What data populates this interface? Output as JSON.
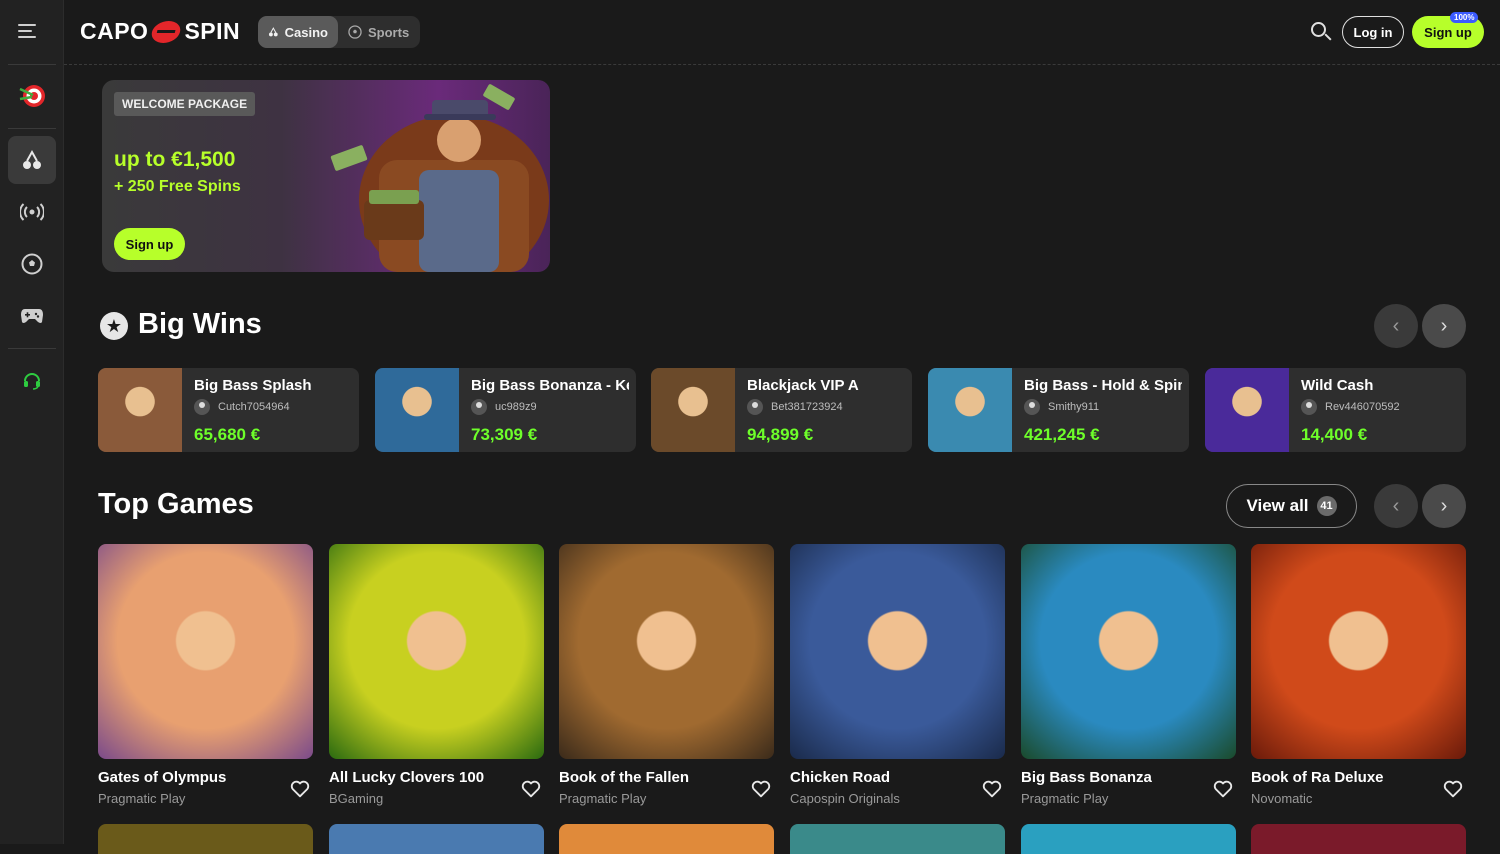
{
  "header": {
    "logo_left": "CAPO",
    "logo_right": "SPIN",
    "tabs": [
      {
        "label": "Casino",
        "icon": "casino-icon",
        "active": true
      },
      {
        "label": "Sports",
        "icon": "soccer-ball-icon",
        "active": false
      }
    ],
    "login_label": "Log in",
    "signup_label": "Sign up",
    "signup_badge": "100%"
  },
  "sidebar": {
    "items": [
      {
        "icon": "target-icon"
      },
      {
        "icon": "casino-icon",
        "active": true
      },
      {
        "icon": "live-broadcast-icon"
      },
      {
        "icon": "soccer-ball-icon"
      },
      {
        "icon": "gamepad-icon"
      },
      {
        "icon": "support-headset-icon"
      }
    ]
  },
  "banner": {
    "tag": "WELCOME PACKAGE",
    "title": "up to €1,500",
    "subtitle": "+ 250 Free Spins",
    "button": "Sign up"
  },
  "big_wins": {
    "title": "Big Wins",
    "items": [
      {
        "game": "Big Bass Splash",
        "user": "Cutch7054964",
        "amount": "65,680 €",
        "color": "#8a5a3a"
      },
      {
        "game": "Big Bass Bonanza - Keeping it Reel",
        "user": "uc989z9",
        "amount": "73,309 €",
        "color": "#2f6a9a"
      },
      {
        "game": "Blackjack VIP A",
        "user": "Bet381723924",
        "amount": "94,899 €",
        "color": "#6b4a2a"
      },
      {
        "game": "Big Bass - Hold & Spinner",
        "user": "Smithy911",
        "amount": "421,245 €",
        "color": "#3a8ab0"
      },
      {
        "game": "Wild Cash",
        "user": "Rev446070592",
        "amount": "14,400 €",
        "color": "#4a2a9a"
      }
    ]
  },
  "top_games": {
    "title": "Top Games",
    "view_all_label": "View all",
    "view_all_count": "41",
    "items": [
      {
        "title": "Gates of Olympus",
        "provider": "Pragmatic Play",
        "color1": "#e8a070",
        "color2": "#7a4a8a"
      },
      {
        "title": "All Lucky Clovers 100",
        "provider": "BGaming",
        "color1": "#c8d020",
        "color2": "#2a6a10"
      },
      {
        "title": "Book of the Fallen",
        "provider": "Pragmatic Play",
        "color1": "#a06a30",
        "color2": "#3a2a1a"
      },
      {
        "title": "Chicken Road",
        "provider": "Capospin Originals",
        "color1": "#3a5a9a",
        "color2": "#1a2a4a"
      },
      {
        "title": "Big Bass Bonanza",
        "provider": "Pragmatic Play",
        "color1": "#2a8ac0",
        "color2": "#1a4a2a"
      },
      {
        "title": "Book of Ra Deluxe",
        "provider": "Novomatic",
        "color1": "#d04a1a",
        "color2": "#6a1a0a"
      }
    ],
    "peek_colors": [
      "#6a5a1a",
      "#4a7ab0",
      "#e08a3a",
      "#3a8a8a",
      "#2aa0c0",
      "#7a1a2a"
    ]
  },
  "colors": {
    "accent": "#b7ff2a",
    "win_amount": "#6eff2a",
    "brand_red": "#e3262a"
  }
}
